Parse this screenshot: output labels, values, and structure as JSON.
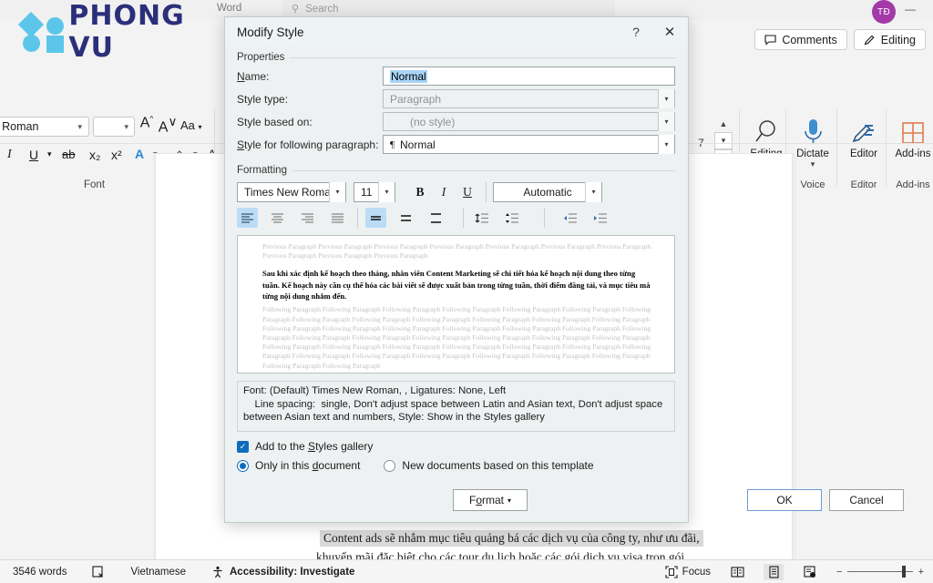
{
  "app": {
    "window_title": "Word",
    "search_placeholder": "Search",
    "search_icon": "search-icon",
    "minimize_label": "—",
    "avatar_initials": "TĐ",
    "comments_label": "Comments",
    "editing_label": "Editing"
  },
  "logo": {
    "text": "PHONG VU",
    "mark_color": "#5bc6ea",
    "text_color": "#2b2f7a"
  },
  "ribbon": {
    "font_group": {
      "caption": "Font",
      "font_name": "es New Roman",
      "font_size": "",
      "grow_font": "A",
      "shrink_font": "A",
      "change_case": "Aa",
      "italic": "I",
      "underline": "U",
      "strikethrough": "ab",
      "subscript": "x₂",
      "superscript": "x²",
      "text_effects": "A",
      "highlight": "A",
      "font_color": "A",
      "dialog_launcher": "⬐"
    },
    "groups": [
      {
        "label": "Editing",
        "caption": "",
        "icon": "magnifier-icon",
        "has_chevron": true
      },
      {
        "label": "Dictate",
        "caption": "Voice",
        "icon": "microphone-icon",
        "has_chevron": true
      },
      {
        "label": "Editor",
        "caption": "Editor",
        "icon": "editor-pen-icon",
        "has_chevron": false
      },
      {
        "label": "Add-ins",
        "caption": "Add-ins",
        "icon": "grid-addins-icon",
        "has_chevron": false
      }
    ],
    "spin_value": "7"
  },
  "dialog": {
    "title": "Modify Style",
    "help_icon": "?",
    "close_icon": "✕",
    "properties_label": "Properties",
    "formatting_label": "Formatting",
    "fields": [
      {
        "label": "Name:",
        "accel": "N",
        "value": "Normal",
        "type": "text",
        "selected": true,
        "disabled": false
      },
      {
        "label": "Style type:",
        "accel": "",
        "value": "Paragraph",
        "type": "combo",
        "selected": false,
        "disabled": true
      },
      {
        "label": "Style based on:",
        "accel": "",
        "value": "(no style)",
        "type": "combo",
        "selected": false,
        "disabled": true
      },
      {
        "label": "Style for following paragraph:",
        "accel": "S",
        "value": "Normal",
        "type": "combo",
        "selected": false,
        "disabled": false,
        "para_mark": "¶"
      }
    ],
    "formatting": {
      "font_family": "Times New Roman",
      "font_size": "11",
      "bold": "B",
      "italic": "I",
      "underline": "U",
      "font_color": "Automatic",
      "align_buttons": [
        {
          "name": "align-left",
          "active": true
        },
        {
          "name": "align-center",
          "active": false
        },
        {
          "name": "align-right",
          "active": false
        },
        {
          "name": "align-justify",
          "active": false
        }
      ],
      "spacing_buttons": [
        {
          "name": "line-spacing-single",
          "active": true
        },
        {
          "name": "line-spacing-1-5",
          "active": false
        },
        {
          "name": "line-spacing-double",
          "active": false
        }
      ],
      "space_buttons": [
        {
          "name": "add-space-before-paragraph",
          "active": false
        },
        {
          "name": "remove-space-after-paragraph",
          "active": false
        }
      ],
      "indent_buttons": [
        {
          "name": "decrease-indent",
          "active": false
        },
        {
          "name": "increase-indent",
          "active": false
        }
      ]
    },
    "preview": {
      "previous_paragraph": "Previous Paragraph Previous Paragraph Previous Paragraph Previous Paragraph Previous Paragraph Previous Paragraph Previous Paragraph Previous Paragraph Previous Paragraph Previous Paragraph",
      "sample_text": "Sau khi xác định kế hoạch theo tháng, nhân viên Content Marketing sẽ chi tiết hóa kế hoạch nội dung theo từng tuần. Kế hoạch này cần cụ thể hóa các bài viết sẽ được xuất bản trong từng tuần, thời điểm đăng tải, và mục tiêu mà từng nội dung nhắm đến.",
      "following_paragraph": "Following Paragraph Following Paragraph Following Paragraph Following Paragraph Following Paragraph Following Paragraph Following Paragraph Following Paragraph Following Paragraph Following Paragraph Following Paragraph Following Paragraph Following Paragraph Following Paragraph Following Paragraph Following Paragraph Following Paragraph Following Paragraph Following Paragraph Following Paragraph Following Paragraph Following Paragraph Following Paragraph Following Paragraph Following Paragraph Following Paragraph Following Paragraph Following Paragraph Following Paragraph Following Paragraph Following Paragraph Following Paragraph Following Paragraph Following Paragraph Following Paragraph Following Paragraph Following Paragraph Following Paragraph Following Paragraph Following Paragraph Following Paragraph"
    },
    "description": "Font: (Default) Times New Roman, , Ligatures: None, Left\n    Line spacing:  single, Don't adjust space between Latin and Asian text, Don't adjust space between Asian text and numbers, Style: Show in the Styles gallery",
    "add_to_gallery_label": "Add to the Styles gallery",
    "add_to_gallery_checked": true,
    "scope_options": [
      {
        "label": "Only in this document",
        "selected": true
      },
      {
        "label": "New documents based on this template",
        "selected": false
      }
    ],
    "buttons": {
      "format": "Format",
      "format_caret": "▾",
      "ok": "OK",
      "cancel": "Cancel"
    }
  },
  "document": {
    "lines": [
      "Content ads sẽ nhắm mục tiêu quảng bá các dịch vụ của công ty, như ưu đãi,",
      "khuyến mãi đặc biệt cho các tour du lịch hoặc các gói dịch vụ visa trọn gói."
    ]
  },
  "status_bar": {
    "word_count": "3546 words",
    "proofing_icon": "proofing-errors-icon",
    "language": "Vietnamese",
    "accessibility_icon": "accessibility-icon",
    "accessibility": "Accessibility: Investigate",
    "focus_label": "Focus",
    "focus_icon": "focus-icon",
    "views": [
      {
        "name": "read-mode-view",
        "active": false
      },
      {
        "name": "print-layout-view",
        "active": true
      },
      {
        "name": "web-layout-view",
        "active": false
      }
    ],
    "zoom_minus": "−",
    "zoom_plus": "+"
  }
}
